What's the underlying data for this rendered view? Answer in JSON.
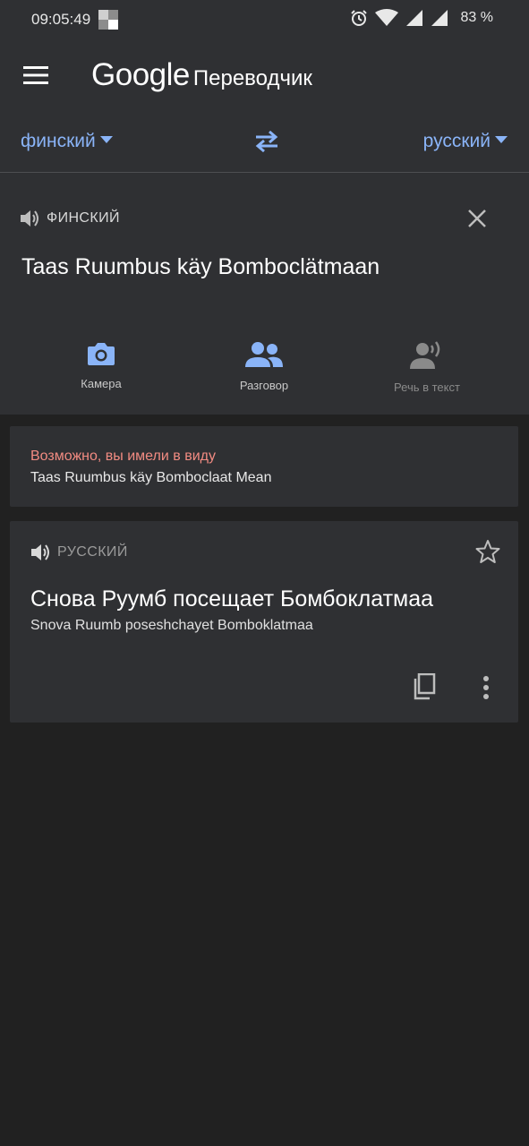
{
  "status_bar": {
    "time": "09:05:49",
    "battery": "83 %",
    "icons": [
      "notification-square-icon",
      "alarm-icon",
      "wifi-icon",
      "signal-icon",
      "signal-icon"
    ]
  },
  "app_bar": {
    "brand": "Google",
    "product": "Переводчик",
    "menu_icon": "hamburger-menu-icon"
  },
  "languages": {
    "source": "финский",
    "target": "русский",
    "swap_icon": "swap-arrows-icon"
  },
  "input": {
    "label": "ФИНСКИЙ",
    "text": "Taas Ruumbus käy Bomboclätmaan",
    "speaker_icon": "speaker-icon",
    "clear_icon": "close-icon"
  },
  "tools": [
    {
      "label": "Камера",
      "icon": "camera-icon"
    },
    {
      "label": "Разговор",
      "icon": "conversation-icon"
    },
    {
      "label": "Речь в текст",
      "icon": "speech-to-text-icon"
    }
  ],
  "suggestion": {
    "hint": "Возможно, вы имели в виду",
    "text": "Taas Ruumbus käy Bomboclaat Mean"
  },
  "result": {
    "label": "РУССКИЙ",
    "translation": "Снова Руумб посещает Бомбоклатмаа",
    "transliteration": "Snova Ruumb poseshchayet Bomboklatmaa",
    "icons": [
      "star-outline-icon",
      "copy-icon",
      "more-vert-icon"
    ]
  },
  "colors": {
    "background": "#212121",
    "surface": "#2f3033",
    "accent": "#8ab4f8",
    "suggestion": "#f28b82"
  }
}
